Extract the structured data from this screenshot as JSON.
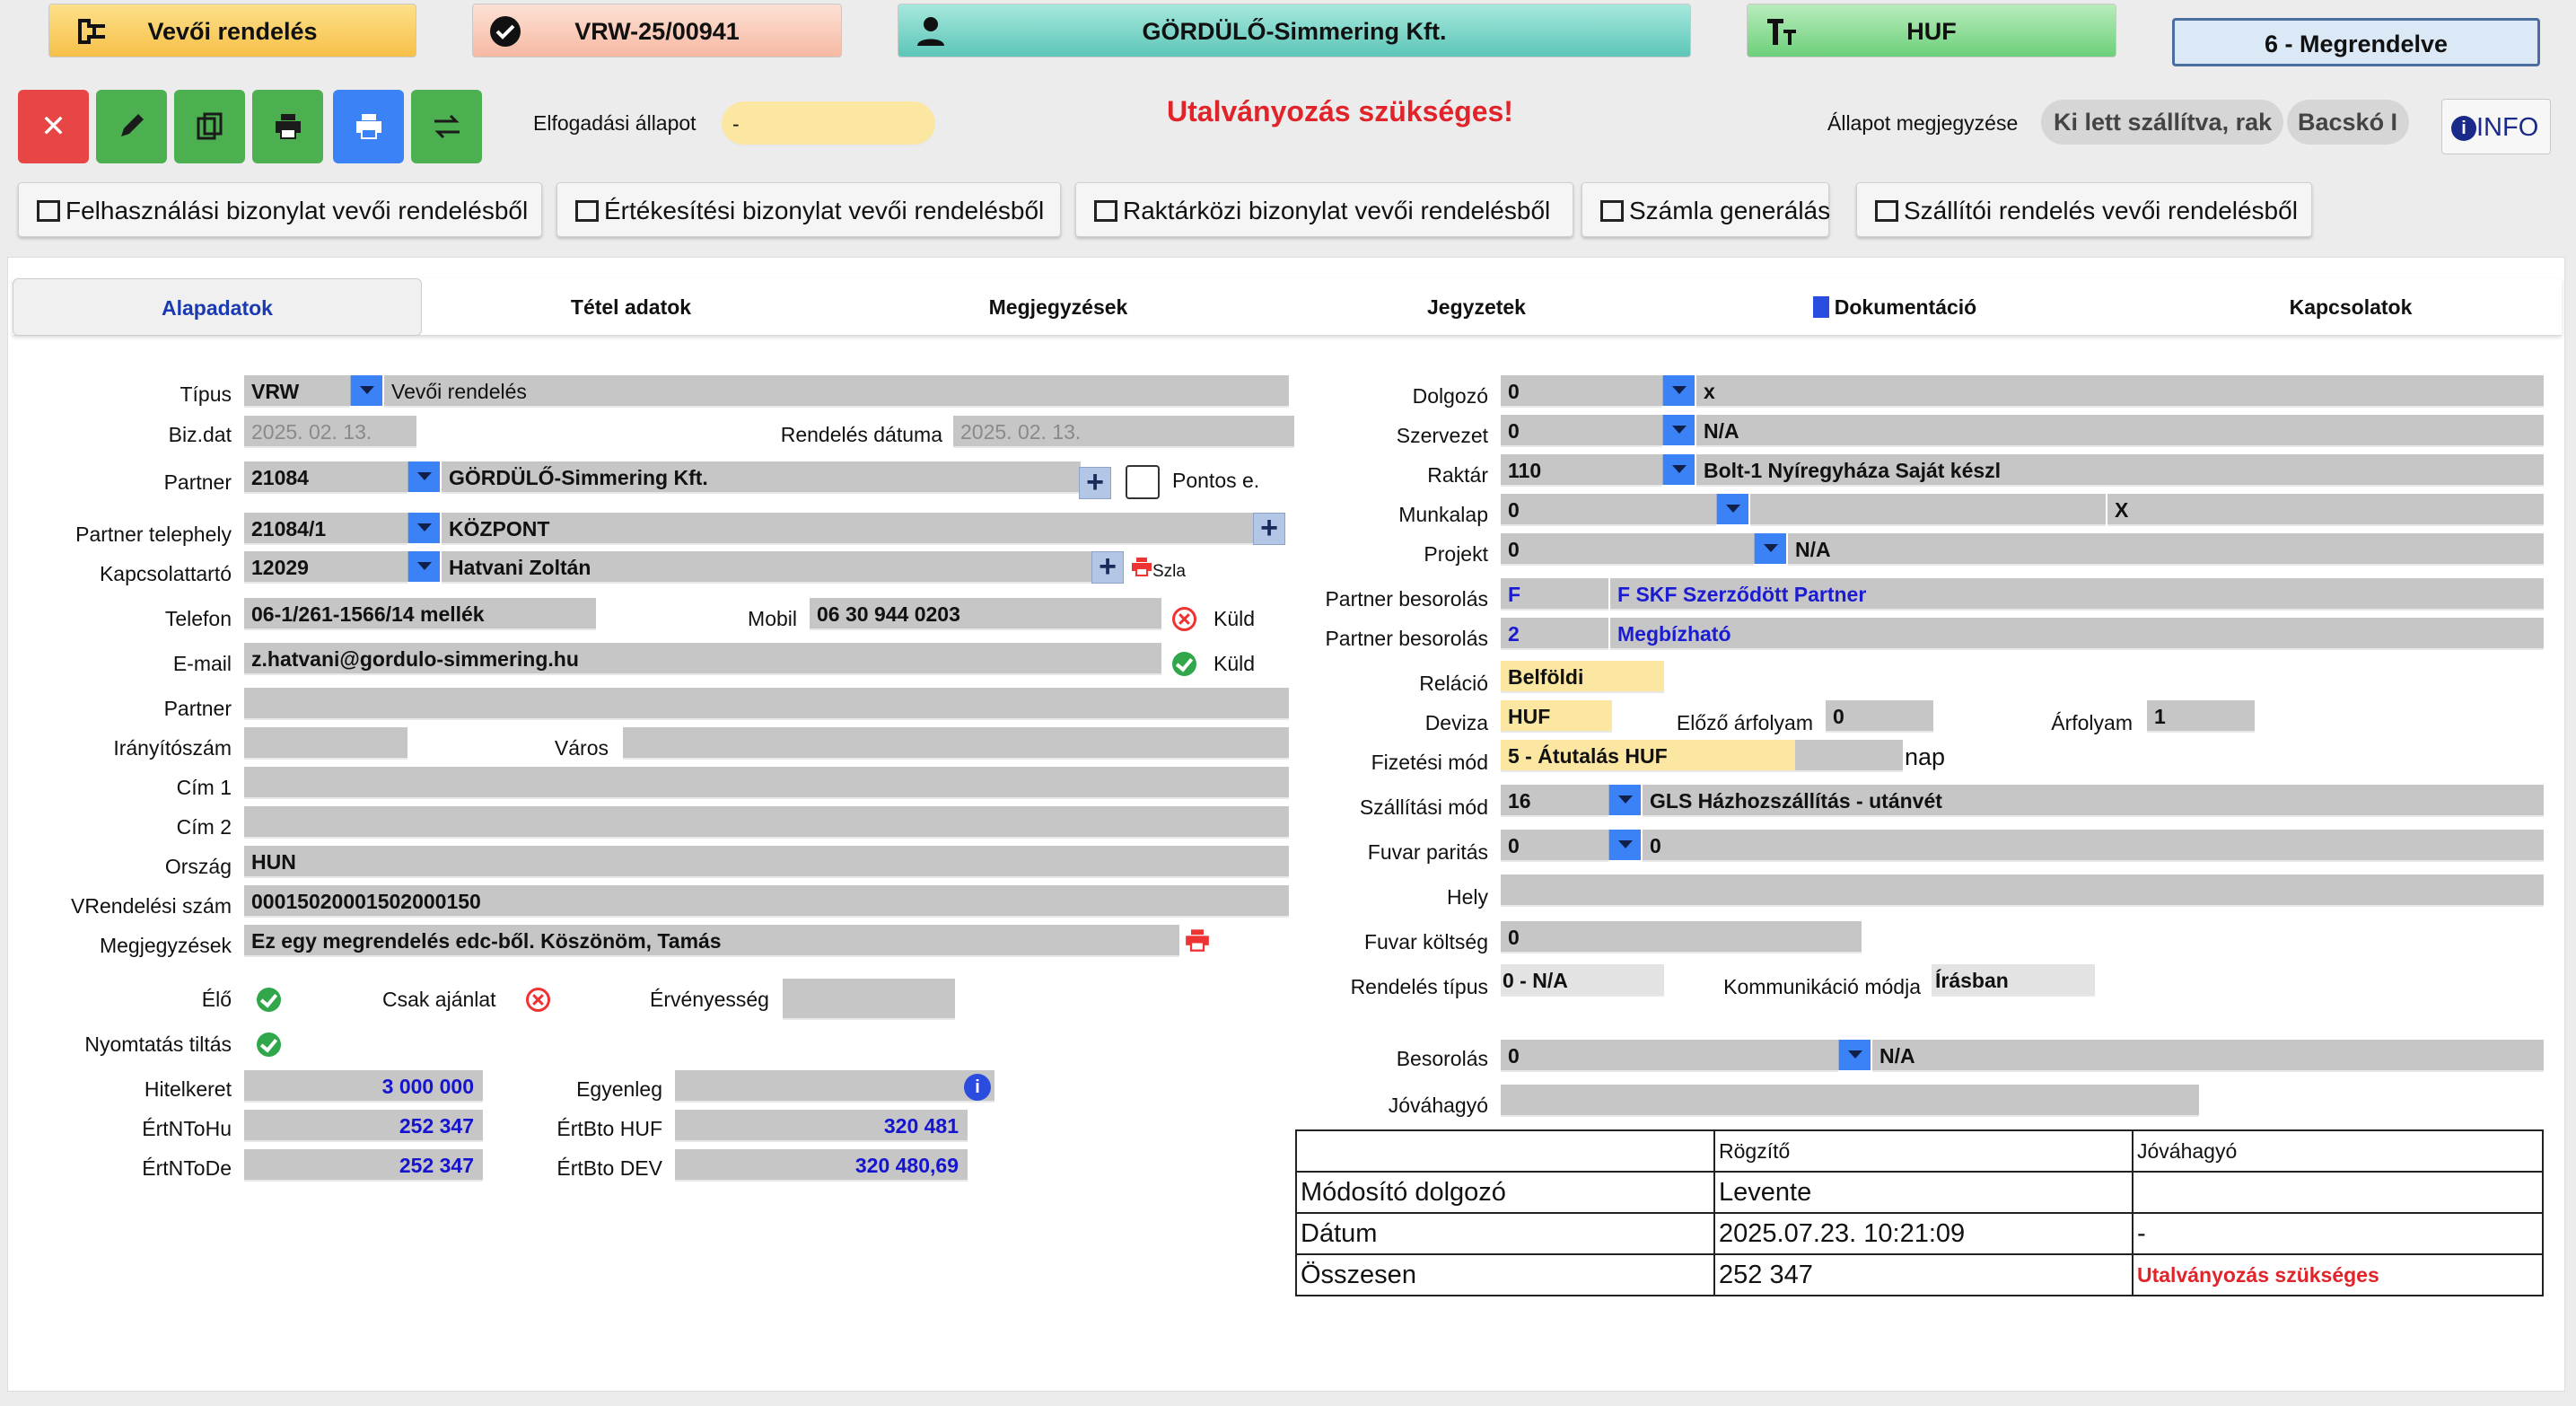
{
  "header": {
    "doc_type": "Vevői rendelés",
    "doc_number": "VRW-25/00941",
    "partner": "GÖRDÜLŐ-Simmering Kft.",
    "currency": "HUF",
    "status": "6 - Megrendelve"
  },
  "actions": {
    "acceptance_label": "Elfogadási állapot",
    "acceptance_value": "-",
    "alert": "Utalványozás szükséges!",
    "status_note_label": "Állapot megjegyzése",
    "chip1": "Ki lett szállítva, rak",
    "chip2": "Bacskó I",
    "info": "INFO"
  },
  "docs": [
    "Felhasználási bizonylat vevői rendelésből",
    "Értékesítési bizonylat vevői rendelésből",
    "Raktárközi bizonylat vevői rendelésből",
    "Számla generálás",
    "Szállítói rendelés vevői rendelésből"
  ],
  "tabs": [
    "Alapadatok",
    "Tétel adatok",
    "Megjegyzések",
    "Jegyzetek",
    "Dokumentáció",
    "Kapcsolatok"
  ],
  "left": {
    "tipus_label": "Típus",
    "tipus_code": "VRW",
    "tipus_name": "Vevői rendelés",
    "bizdat_label": "Biz.dat",
    "bizdat": "2025. 02. 13.",
    "rend_datum_label": "Rendelés dátuma",
    "rend_datum": "2025. 02. 13.",
    "partner_label": "Partner",
    "partner_code": "21084",
    "partner_name": "GÖRDÜLŐ-Simmering Kft.",
    "pontos_label": "Pontos e.",
    "telephely_label": "Partner telephely",
    "telephely_code": "21084/1",
    "telephely_name": "KÖZPONT",
    "kapcs_label": "Kapcsolattartó",
    "kapcs_code": "12029",
    "kapcs_name": "Hatvani Zoltán",
    "szla": "Szla",
    "telefon_label": "Telefon",
    "telefon": "06-1/261-1566/14 mellék",
    "mobil_label": "Mobil",
    "mobil": "06 30 944 0203",
    "kuld": "Küld",
    "email_label": "E-mail",
    "email": "z.hatvani@gordulo-simmering.hu",
    "partner2_label": "Partner",
    "irsz_label": "Irányítószám",
    "varos_label": "Város",
    "cim1_label": "Cím 1",
    "cim2_label": "Cím 2",
    "orszag_label": "Ország",
    "orszag": "HUN",
    "vrend_label": "VRendelési szám",
    "vrend": "00015020001502000150",
    "megj_label": "Megjegyzések",
    "megj": "Ez egy megrendelés edc-ből. Köszönöm, Tamás",
    "elo_label": "Élő",
    "csak_label": "Csak ajánlat",
    "erv_label": "Érvényesség",
    "nyomt_label": "Nyomtatás tiltás",
    "hitel_label": "Hitelkeret",
    "hitel": "3 000 000",
    "egyenleg_label": "Egyenleg",
    "ertntohu_label": "ÉrtNToHu",
    "ertntohu": "252 347",
    "ertbtohuf_label": "ÉrtBto HUF",
    "ertbtohuf": "320 481",
    "ertntode_label": "ÉrtNToDe",
    "ertntode": "252 347",
    "ertbtodev_label": "ÉrtBto DEV",
    "ertbtodev": "320 480,69"
  },
  "right": {
    "dolgozo_label": "Dolgozó",
    "dolgozo_code": "0",
    "dolgozo_name": "x",
    "szervezet_label": "Szervezet",
    "szervezet_code": "0",
    "szervezet_name": "N/A",
    "raktar_label": "Raktár",
    "raktar_code": "110",
    "raktar_name": "Bolt-1 Nyíregyháza Saját készl",
    "munkalap_label": "Munkalap",
    "munkalap_code": "0",
    "munkalap_x": "X",
    "projekt_label": "Projekt",
    "projekt_code": "0",
    "projekt_name": "N/A",
    "pb1_label": "Partner besorolás",
    "pb1_code": "F",
    "pb1_name": "F SKF Szerződött Partner",
    "pb2_label": "Partner besorolás",
    "pb2_code": "2",
    "pb2_name": "Megbízható",
    "relacio_label": "Reláció",
    "relacio": "Belföldi",
    "deviza_label": "Deviza",
    "deviza": "HUF",
    "elozo_label": "Előző árfolyam",
    "elozo": "0",
    "arfolyam_label": "Árfolyam",
    "arfolyam": "1",
    "fizmod_label": "Fizetési mód",
    "fizmod": "5 - Átutalás HUF",
    "nap": "nap",
    "szallmod_label": "Szállítási mód",
    "szallmod_code": "16",
    "szallmod_name": "GLS Házhozszállítás - utánvét",
    "fuvar_label": "Fuvar paritás",
    "fuvar_code": "0",
    "fuvar_name": "0",
    "hely_label": "Hely",
    "fuvark_label": "Fuvar költség",
    "fuvark": "0",
    "rendtip_label": "Rendelés típus",
    "rendtip": "0 - N/A",
    "komm_label": "Kommunikáció módja",
    "komm": "Írásban",
    "besorolas_label": "Besorolás",
    "besorolas_code": "0",
    "besorolas_name": "N/A",
    "jovahagy_label": "Jóváhagyó"
  },
  "log": {
    "h_rogzito": "Rögzítő",
    "h_jovahagyo": "Jóváhagyó",
    "r1_label": "Módosító dolgozó",
    "r1_rog": "Levente",
    "r1_jov": "",
    "r2_label": "Dátum",
    "r2_rog": "2025.07.23. 10:21:09",
    "r2_jov": "-",
    "r3_label": "Összesen",
    "r3_rog": "252 347",
    "r3_jov": "Utalványozás szükséges"
  },
  "colors": {
    "accent_blue": "#3b82f6",
    "alert_red": "#e0242a",
    "green": "#4caf50",
    "teal": "#5cc6b8"
  }
}
